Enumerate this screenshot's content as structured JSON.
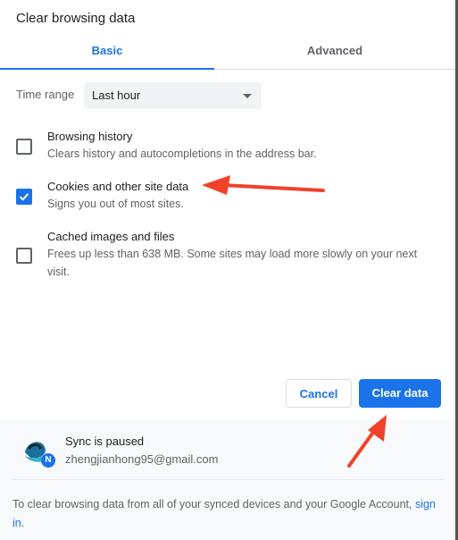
{
  "dialog": {
    "title": "Clear browsing data"
  },
  "tabs": [
    {
      "label": "Basic",
      "active": true
    },
    {
      "label": "Advanced",
      "active": false
    }
  ],
  "time_range": {
    "label": "Time range",
    "value": "Last hour"
  },
  "items": [
    {
      "title": "Browsing history",
      "desc": "Clears history and autocompletions in the address bar.",
      "checked": false
    },
    {
      "title": "Cookies and other site data",
      "desc": "Signs you out of most sites.",
      "checked": true
    },
    {
      "title": "Cached images and files",
      "desc": "Frees up less than 638 MB. Some sites may load more slowly on your next visit.",
      "checked": false
    }
  ],
  "buttons": {
    "cancel": "Cancel",
    "clear": "Clear data"
  },
  "sync": {
    "status": "Sync is paused",
    "email": "zhengjianhong95@gmail.com",
    "badge": "N"
  },
  "footer": {
    "text": "To clear browsing data from all of your synced devices and your Google Account, ",
    "link": "sign in."
  },
  "colors": {
    "accent": "#1a73e8",
    "annotation_arrow": "#f0422a"
  }
}
